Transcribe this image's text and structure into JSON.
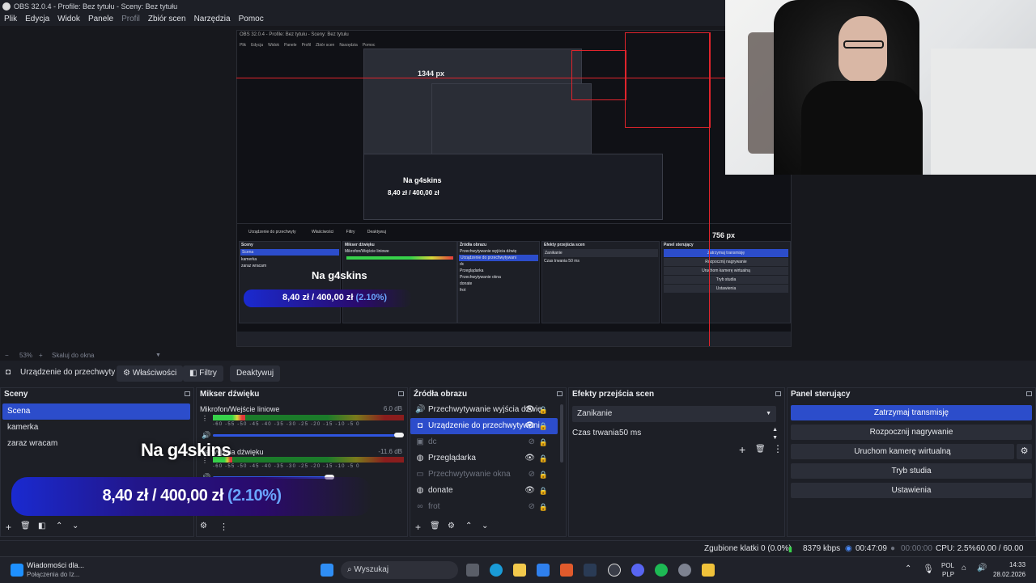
{
  "window": {
    "title": "OBS 32.0.4 - Profile: Bez tytułu - Sceny: Bez tytułu"
  },
  "menu": [
    "Plik",
    "Edycja",
    "Widok",
    "Panele",
    "Profil",
    "Zbiór scen",
    "Narzędzia",
    "Pomoc"
  ],
  "preview": {
    "label_horizontal": "1344 px",
    "label_horizontal_small": "1344 px",
    "label_vertical": "756 px",
    "label_vertical_small": "756 px",
    "nested_overlay_text": "Na g4skins",
    "nested_amount_main": "8,40 zł / 400,00 zł",
    "nested_amount_pct": "(2.10%)"
  },
  "zoom": {
    "minus": "−",
    "value": "53%",
    "plus": "+",
    "mode": "Skaluj do okna"
  },
  "source_toolbar": {
    "source_name": "Urządzenie do przechwyty",
    "properties": "Właściwości",
    "filters": "Filtry",
    "deactivate": "Deaktywuj"
  },
  "scenes": {
    "title": "Sceny",
    "items": [
      {
        "label": "Scena",
        "selected": true
      },
      {
        "label": "kamerka",
        "selected": false
      },
      {
        "label": "zaraz wracam",
        "selected": false
      }
    ]
  },
  "mixer": {
    "title": "Mikser dźwięku",
    "channels": [
      {
        "name": "Mikrofon/Wejście liniowe",
        "db": "6.0 dB"
      },
      {
        "name": "Przechwytywanie wyjścia dźwięku",
        "visible_name": "nie wyjścia dźwięku",
        "db": "-11.6 dB"
      }
    ],
    "ticks": "-60 -55 -50 -45 -40 -35 -30 -25 -20 -15 -10 -5 0"
  },
  "sources": {
    "title": "Źródła obrazu",
    "items": [
      {
        "label": "Przechwytywanie wyjścia dźwię",
        "icon": "speaker-icon",
        "visible": true,
        "selected": false
      },
      {
        "label": "Urządzenie do przechwytywani",
        "icon": "camera-icon",
        "visible": true,
        "selected": true
      },
      {
        "label": "dc",
        "icon": "image-icon",
        "visible": false,
        "selected": false
      },
      {
        "label": "Przeglądarka",
        "icon": "globe-icon",
        "visible": true,
        "selected": false
      },
      {
        "label": "Przechwytywanie okna",
        "icon": "window-icon",
        "visible": false,
        "selected": false
      },
      {
        "label": "donate",
        "icon": "globe-icon",
        "visible": true,
        "selected": false
      },
      {
        "label": "frot",
        "icon": "link-icon",
        "visible": false,
        "selected": false
      }
    ]
  },
  "transitions": {
    "title": "Efekty przejścia scen",
    "selected": "Zanikanie",
    "duration_label": "Czas trwania",
    "duration_value": "50 ms"
  },
  "controls": {
    "title": "Panel sterujący",
    "buttons": [
      "Zatrzymaj transmisję",
      "Rozpocznij nagrywanie",
      "Uruchom kamerę wirtualną",
      "Tryb studia",
      "Ustawienia"
    ]
  },
  "overlay": {
    "text": "Na g4skins",
    "amount_main": "8,40 zł / 400,00 zł",
    "amount_pct": "(2.10%)"
  },
  "status": {
    "dropped": "Zgubione klatki 0 (0.0%)",
    "bitrate": "8379 kbps",
    "stream_time": "00:47:09",
    "rec_time": "00:00:00",
    "cpu": "CPU: 2.5%",
    "fps": "60.00 / 60.00 FPS"
  },
  "taskbar": {
    "notif_title": "Wiadomości dla...",
    "notif_sub": "Połączenia do Iz...",
    "search_placeholder": "Wyszukaj",
    "lang_top": "POL",
    "lang_bottom": "PLP",
    "time": "14:33",
    "date": "28.02.2026"
  },
  "colors": {
    "accent": "#2c4dcb",
    "red_guides": "#e0242c",
    "bg": "#1d1f26"
  }
}
